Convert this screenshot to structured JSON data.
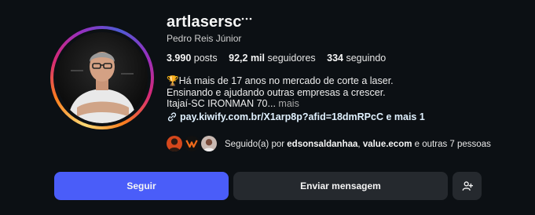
{
  "profile": {
    "username": "artlasersc",
    "full_name": "Pedro Reis Júnior",
    "avatar_icon": "profile-photo"
  },
  "stats": {
    "posts_value": "3.990",
    "posts_label": "posts",
    "followers_value": "92,2 mil",
    "followers_label": "seguidores",
    "following_value": "334",
    "following_label": "seguindo"
  },
  "bio": {
    "line1": "🏆Há mais de 17 anos no mercado de corte a laser.",
    "line2": "Ensinando e ajudando outras empresas a crescer.",
    "line3": "Itajaí-SC IRONMAN 70...",
    "more_label": "mais"
  },
  "link": {
    "text": "pay.kiwify.com.br/X1arp8p?afid=18dmRPcC e mais 1",
    "icon": "link-icon"
  },
  "followed_by": {
    "prefix": "Seguido(a) por",
    "user1": "edsonsaldanhaa",
    "separator": ",",
    "user2": "value.ecom",
    "suffix": "e outras 7 pessoas"
  },
  "buttons": {
    "follow": "Seguir",
    "message": "Enviar mensagem",
    "suggest_icon": "add-person-icon"
  },
  "colors": {
    "background": "#0c1014",
    "follow_button": "#4a5df9",
    "secondary_button": "#25292e"
  }
}
